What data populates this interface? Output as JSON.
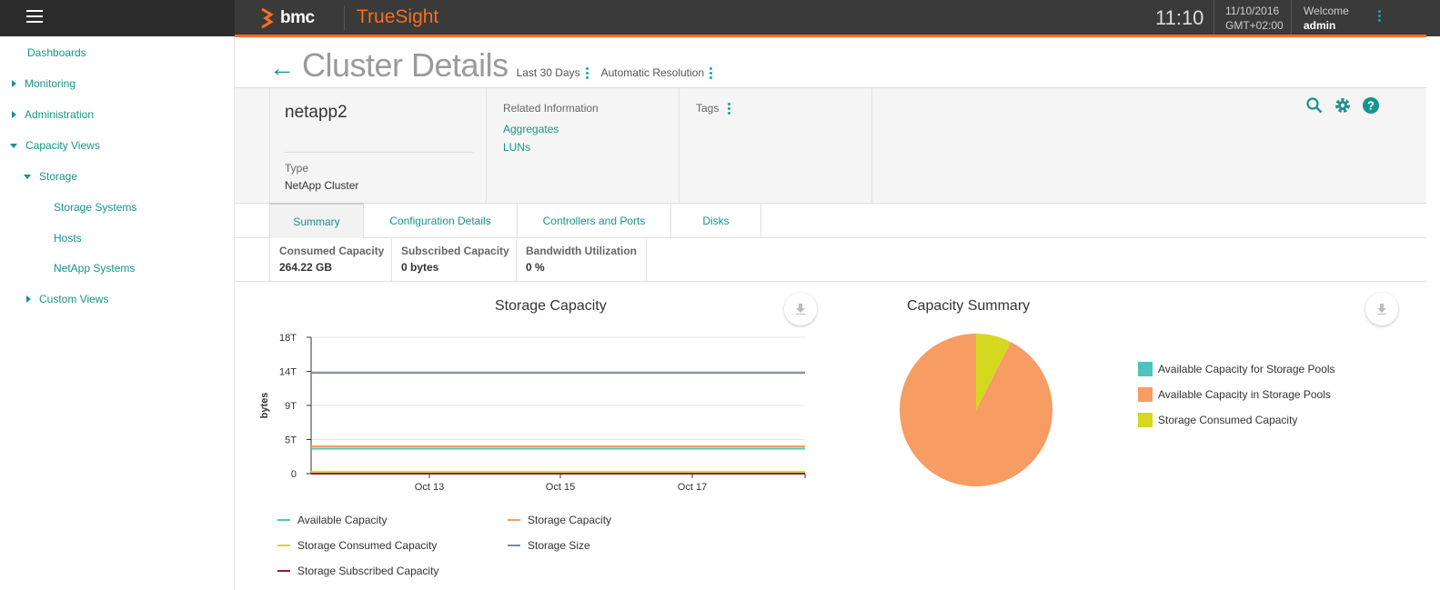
{
  "header": {
    "brand": "bmc",
    "product": "TrueSight",
    "time": "11:10",
    "date": "11/10/2016",
    "timezone": "GMT+02:00",
    "welcome_label": "Welcome",
    "user": "admin",
    "brand_color": "#f37021"
  },
  "sidebar": {
    "dashboards": "Dashboards",
    "monitoring": "Monitoring",
    "administration": "Administration",
    "capacity_views": "Capacity Views",
    "storage": "Storage",
    "storage_systems": "Storage Systems",
    "hosts": "Hosts",
    "netapp_systems": "NetApp Systems",
    "custom_views": "Custom Views"
  },
  "page": {
    "title": "Cluster Details",
    "time_range": "Last 30 Days",
    "resolution": "Automatic Resolution"
  },
  "details": {
    "name": "netapp2",
    "type_label": "Type",
    "type_value": "NetApp Cluster",
    "related_label": "Related Information",
    "related_links": [
      "Aggregates",
      "LUNs"
    ],
    "tags_label": "Tags"
  },
  "tabs": [
    "Summary",
    "Configuration Details",
    "Controllers and Ports",
    "Disks"
  ],
  "metrics": [
    {
      "label": "Consumed Capacity",
      "value": "264.22 GB"
    },
    {
      "label": "Subscribed Capacity",
      "value": "0 bytes"
    },
    {
      "label": "Bandwidth Utilization",
      "value": "0 %"
    }
  ],
  "chart_data": [
    {
      "type": "line",
      "title": "Storage Capacity",
      "xlabel": "",
      "ylabel": "bytes",
      "y_ticks": [
        "0",
        "5T",
        "9T",
        "14T",
        "18T"
      ],
      "x_ticks": [
        "Oct 13",
        "Oct 15",
        "Oct 17"
      ],
      "ylim": [
        0,
        18
      ],
      "grid": true,
      "legend": "bottom",
      "series": [
        {
          "name": "Available Capacity",
          "color": "#4fc3c0",
          "values": [
            3.3,
            3.3
          ]
        },
        {
          "name": "Storage Capacity",
          "color": "#f79c63",
          "values": [
            3.6,
            3.6
          ]
        },
        {
          "name": "Storage Consumed Capacity",
          "color": "#d4d920",
          "values": [
            0.26,
            0.26
          ]
        },
        {
          "name": "Storage Size",
          "color": "#7b8ba0",
          "values": [
            13.3,
            13.3
          ]
        },
        {
          "name": "Storage Subscribed Capacity",
          "color": "#8b1a4a",
          "values": [
            0,
            0
          ]
        }
      ]
    },
    {
      "type": "pie",
      "title": "Capacity Summary",
      "legend": "right",
      "slices": [
        {
          "name": "Available Capacity for Storage Pools",
          "color": "#4fc3c0",
          "value": 0
        },
        {
          "name": "Available Capacity in Storage Pools",
          "color": "#f79c63",
          "value": 92.5
        },
        {
          "name": "Storage Consumed Capacity",
          "color": "#d4d920",
          "value": 7.5
        }
      ]
    }
  ]
}
